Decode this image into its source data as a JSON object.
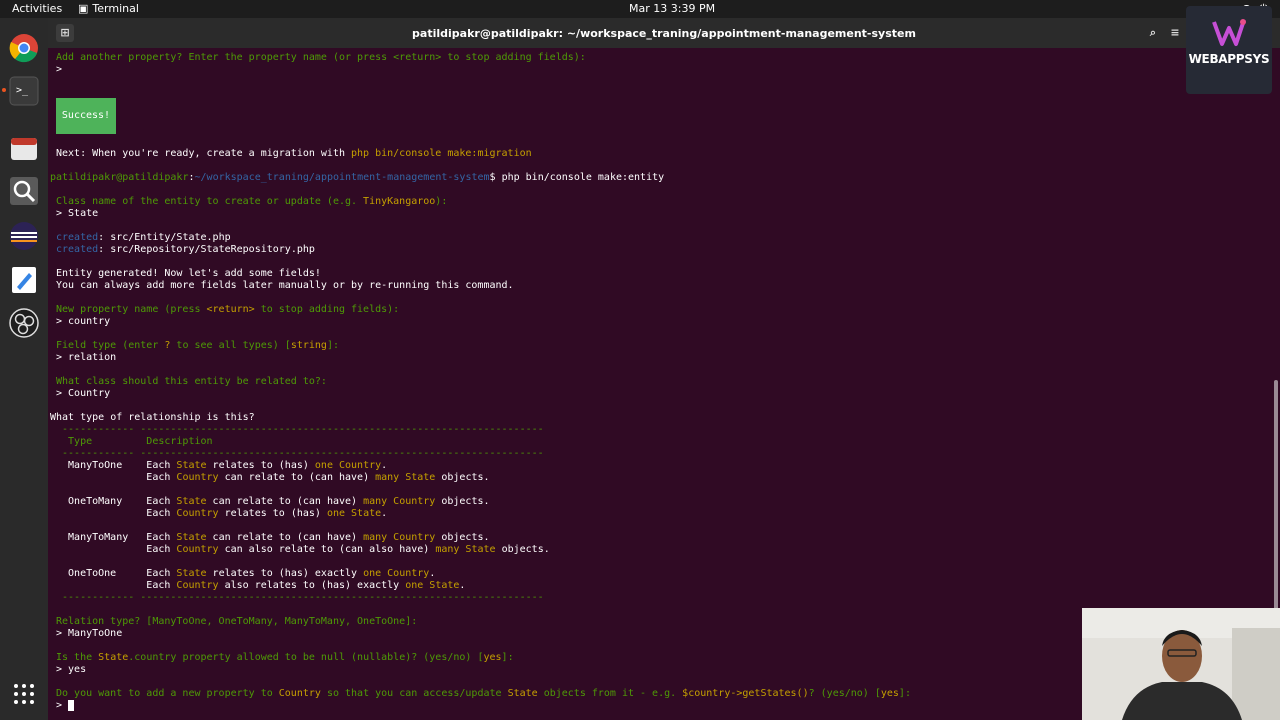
{
  "topbar": {
    "activities": "Activities",
    "app_name": "Terminal",
    "clock": "Mar 13  3:39 PM"
  },
  "window": {
    "title": "patildipakr@patildipakr: ~/workspace_traning/appointment-management-system"
  },
  "dock": {
    "items": [
      "chrome-icon",
      "terminal-icon",
      "files-icon",
      "search-app-icon",
      "eclipse-icon",
      "text-editor-icon",
      "obs-icon",
      "app-grid-icon"
    ]
  },
  "logo": {
    "text": "WEBAPPSYS"
  },
  "terminal": {
    "lines": [
      [
        [
          "g",
          "Add another property? Enter the property name (or press <return> to stop adding fields):"
        ]
      ],
      [
        [
          "w",
          "> "
        ]
      ],
      [
        [
          "w",
          "Next: When you're ready, create a migration with "
        ],
        [
          "y",
          "php bin/console make:migration"
        ]
      ],
      [
        [
          "g",
          "patildipakr@patildipakr"
        ],
        [
          "w",
          ":"
        ],
        [
          "b",
          "~/workspace_traning/appointment-management-system"
        ],
        [
          "w",
          "$ php bin/console make:entity"
        ]
      ],
      [
        [
          "g",
          "Class name of the entity to create or update (e.g. "
        ],
        [
          "y",
          "TinyKangaroo"
        ],
        [
          "g",
          "):"
        ]
      ],
      [
        [
          "w",
          "> State"
        ]
      ],
      [
        [
          "b",
          "created"
        ],
        [
          "w",
          ": src/Entity/State.php"
        ]
      ],
      [
        [
          "b",
          "created"
        ],
        [
          "w",
          ": src/Repository/StateRepository.php"
        ]
      ],
      [
        [
          "w",
          "Entity generated! Now let's add some fields!"
        ]
      ],
      [
        [
          "w",
          "You can always add more fields later manually or by re-running this command."
        ]
      ],
      [
        [
          "g",
          "New property name (press "
        ],
        [
          "y",
          "<return>"
        ],
        [
          "g",
          " to stop adding fields):"
        ]
      ],
      [
        [
          "w",
          "> country"
        ]
      ],
      [
        [
          "g",
          "Field type (enter "
        ],
        [
          "y",
          "?"
        ],
        [
          "g",
          " to see all types) ["
        ],
        [
          "y",
          "string"
        ],
        [
          "g",
          "]:"
        ]
      ],
      [
        [
          "w",
          "> relation"
        ]
      ],
      [
        [
          "g",
          "What class should this entity be related to?:"
        ]
      ],
      [
        [
          "w",
          "> Country"
        ]
      ],
      [
        [
          "w",
          "What type of relationship is this?"
        ]
      ],
      [
        [
          "g",
          " ------------ -------------------------------------------------------------------"
        ]
      ],
      [
        [
          "g",
          "  Type         Description"
        ]
      ],
      [
        [
          "g",
          " ------------ -------------------------------------------------------------------"
        ]
      ],
      [
        [
          "w",
          "  ManyToOne    Each "
        ],
        [
          "y",
          "State"
        ],
        [
          "w",
          " relates to (has) "
        ],
        [
          "y",
          "one Country"
        ],
        [
          "w",
          "."
        ]
      ],
      [
        [
          "w",
          "               Each "
        ],
        [
          "y",
          "Country"
        ],
        [
          "w",
          " can relate to (can have) "
        ],
        [
          "y",
          "many State"
        ],
        [
          "w",
          " objects."
        ]
      ],
      [
        [
          "w",
          "  OneToMany    Each "
        ],
        [
          "y",
          "State"
        ],
        [
          "w",
          " can relate to (can have) "
        ],
        [
          "y",
          "many Country"
        ],
        [
          "w",
          " objects."
        ]
      ],
      [
        [
          "w",
          "               Each "
        ],
        [
          "y",
          "Country"
        ],
        [
          "w",
          " relates to (has) "
        ],
        [
          "y",
          "one State"
        ],
        [
          "w",
          "."
        ]
      ],
      [
        [
          "w",
          "  ManyToMany   Each "
        ],
        [
          "y",
          "State"
        ],
        [
          "w",
          " can relate to (can have) "
        ],
        [
          "y",
          "many Country"
        ],
        [
          "w",
          " objects."
        ]
      ],
      [
        [
          "w",
          "               Each "
        ],
        [
          "y",
          "Country"
        ],
        [
          "w",
          " can also relate to (can also have) "
        ],
        [
          "y",
          "many State"
        ],
        [
          "w",
          " objects."
        ]
      ],
      [
        [
          "w",
          "  OneToOne     Each "
        ],
        [
          "y",
          "State"
        ],
        [
          "w",
          " relates to (has) exactly "
        ],
        [
          "y",
          "one Country"
        ],
        [
          "w",
          "."
        ]
      ],
      [
        [
          "w",
          "               Each "
        ],
        [
          "y",
          "Country"
        ],
        [
          "w",
          " also relates to (has) exactly "
        ],
        [
          "y",
          "one State"
        ],
        [
          "w",
          "."
        ]
      ],
      [
        [
          "g",
          " ------------ -------------------------------------------------------------------"
        ]
      ],
      [
        [
          "g",
          "Relation type? [ManyToOne, OneToMany, ManyToMany, OneToOne]:"
        ]
      ],
      [
        [
          "w",
          "> ManyToOne"
        ]
      ],
      [
        [
          "g",
          "Is the "
        ],
        [
          "y",
          "State"
        ],
        [
          "g",
          ".country property allowed to be null (nullable)? (yes/no) ["
        ],
        [
          "y",
          "yes"
        ],
        [
          "g",
          "]:"
        ]
      ],
      [
        [
          "w",
          "> yes"
        ]
      ],
      [
        [
          "g",
          "Do you want to add a new property to "
        ],
        [
          "y",
          "Country"
        ],
        [
          "g",
          " so that you can access/update "
        ],
        [
          "y",
          "State"
        ],
        [
          "g",
          " objects from it - e.g. "
        ],
        [
          "y",
          "$country->getStates()"
        ],
        [
          "g",
          "? (yes/no) ["
        ],
        [
          "y",
          "yes"
        ],
        [
          "g",
          "]:"
        ]
      ],
      [
        [
          "w",
          "> "
        ]
      ]
    ],
    "success_label": "Success!"
  },
  "colors": {
    "terminal_bg": "#300a24",
    "prompt_green": "#4e9a06",
    "path_blue": "#3465a4",
    "highlight_yellow": "#c4a000",
    "success_bg": "#4eb35a"
  }
}
